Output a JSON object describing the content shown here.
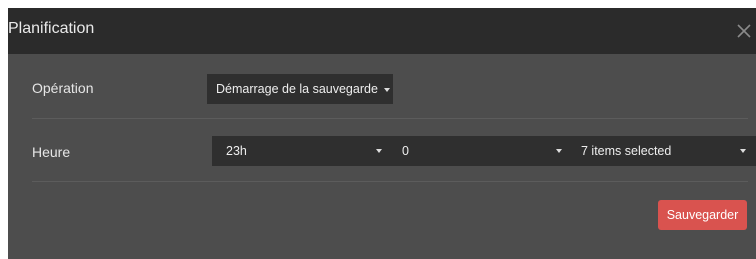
{
  "modal": {
    "title": "Planification",
    "close_icon": "close-icon"
  },
  "operation": {
    "label": "Opération",
    "selected": "Démarrage de la sauvegarde"
  },
  "heure": {
    "label": "Heure",
    "hour_value": "23h",
    "minute_value": "0",
    "days_value": "7 items selected"
  },
  "footer": {
    "save_label": "Sauvegarder"
  },
  "colors": {
    "header_bg": "#2b2b2b",
    "body_bg": "#4d4d4d",
    "control_bg": "#2f2f2f",
    "save_button": "#d9534f"
  }
}
